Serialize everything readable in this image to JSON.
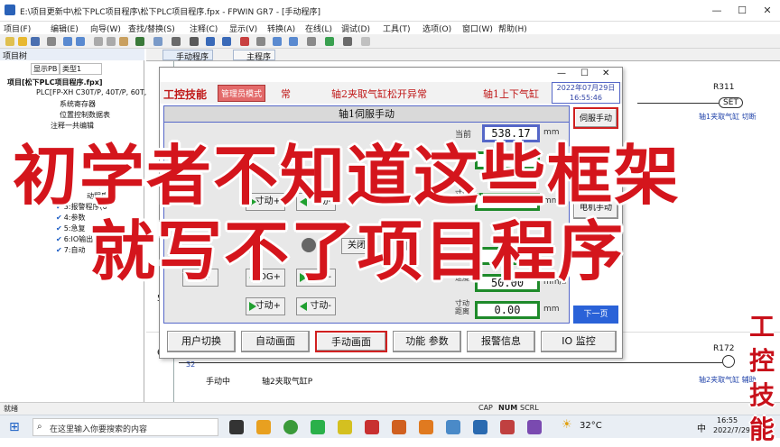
{
  "window": {
    "title": "E:\\项目更新中\\松下PLC项目程序\\松下PLC项目程序.fpx - FPWIN GR7 - [手动程序]",
    "controls": [
      "—",
      "☐",
      "✕"
    ]
  },
  "menu": [
    "项目(F)",
    "编辑(E)",
    "向导(W)",
    "查找/替换(S)",
    "注释(C)",
    "显示(V)",
    "转换(A)",
    "在线(L)",
    "调试(D)",
    "工具(T)",
    "选项(O)",
    "窗口(W)",
    "帮助(H)"
  ],
  "left_panel": {
    "header": "项目树",
    "display_label": "显示PB",
    "type_label": "类型1",
    "items": [
      "项目[松下PLC项目程序.fpx]",
      "PLC[FP-XH C30T/P, 40T/P, 60T,",
      "系统寄存器",
      "位置控制数据表",
      "注释一共编辑",
      "序(86)",
      "动程序(4",
      "3:报警程序(0",
      "4:参数",
      "5:急复",
      "6:IO输出",
      "7:自动"
    ]
  },
  "tabs": [
    "手动程序",
    "主程序"
  ],
  "ladder": {
    "row_numbers": [
      "5",
      "6"
    ],
    "left_rows": [
      "24",
      "32"
    ],
    "contacts": [
      "手动中",
      "轴2夹取气缸P"
    ],
    "coils": [
      {
        "id": "R311",
        "label": "SET",
        "comment": "轴1夹取气缸 切断"
      },
      {
        "id": "R172",
        "label": "",
        "comment": "轴2夹取气缸 辅助"
      }
    ]
  },
  "dialog": {
    "logo_text": "工控技能",
    "admin_mode": "管理员模式",
    "marquee": [
      "常",
      "轴2夹取气缸松开异常",
      "轴1上下气缸"
    ],
    "date": "2022年07月29日",
    "time": "16:55:46",
    "panel_title": "轴1伺服手动",
    "fields": [
      {
        "label": "当前",
        "value": "538.17",
        "unit": "mm"
      },
      {
        "label": "",
        "value": "",
        "unit": ""
      },
      {
        "label": "寸动距离",
        "value": "10.00",
        "unit": "mm"
      },
      {
        "label": "",
        "value": "",
        "unit": "mm"
      },
      {
        "label": "速度",
        "value": "50.00",
        "unit": "mm/s"
      },
      {
        "label": "寸动距离",
        "value": "0.00",
        "unit": "mm"
      }
    ],
    "buttons": {
      "inch_plus": "寸动+",
      "inch_minus": "寸动-",
      "jog_plus": "JOG+",
      "jog_minus": "JOG-",
      "origin": "回零",
      "close": "关闭",
      "servo_manual": "伺服手动",
      "motor_manual": "电机手动",
      "next": "下一页"
    },
    "bottom_nav": [
      "用户切换",
      "自动画面",
      "手动画面",
      "功能 参数",
      "报警信息",
      "IO 监控"
    ]
  },
  "overlay": {
    "line1": "初学者不知道这些框架",
    "line2": "就写不了项目程序",
    "watermark": "工控技能"
  },
  "status_bar": {
    "left": "就绪",
    "indicators": [
      "CAP",
      "NUM",
      "SCRL"
    ]
  },
  "taskbar": {
    "search_placeholder": "在这里输入你要搜索的内容",
    "weather": "32°C",
    "time": "16:55",
    "date": "2022/7/29",
    "ime": "中"
  },
  "colors": {
    "accent_red": "#d4151c",
    "panel_green": "#1e8a2a",
    "dialog_blue": "#5567c8"
  }
}
